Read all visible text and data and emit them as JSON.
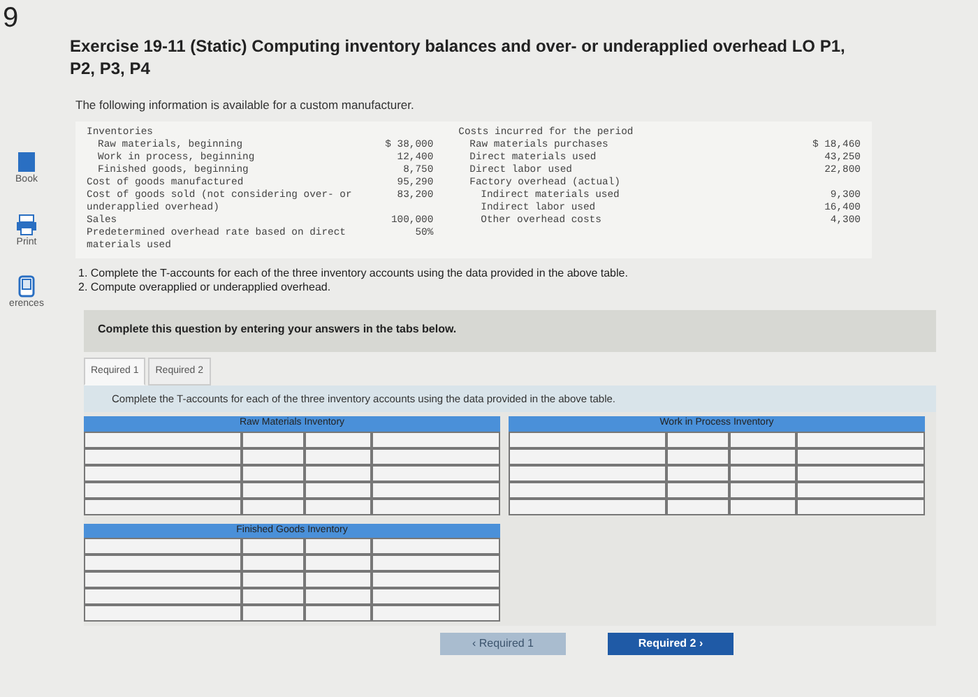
{
  "question_number": "9",
  "sidebar": [
    {
      "label": "Book",
      "kind": "book"
    },
    {
      "label": "Print",
      "kind": "print"
    },
    {
      "label": "erences",
      "kind": "references"
    }
  ],
  "title": "Exercise 19-11 (Static) Computing inventory balances and over- or underapplied overhead LO P1, P2, P3, P4",
  "intro": "The following information is available for a custom manufacturer.",
  "left_table": [
    {
      "label": "Inventories",
      "children": [
        {
          "label": "Raw materials, beginning",
          "value": "$ 38,000"
        },
        {
          "label": "Work in process, beginning",
          "value": "12,400"
        },
        {
          "label": "Finished goods, beginning",
          "value": "8,750"
        }
      ]
    },
    {
      "label": "Cost of goods manufactured",
      "value": "95,290"
    },
    {
      "label": "Cost of goods sold (not considering over- or underapplied overhead)",
      "value": "83,200"
    },
    {
      "label": "Sales",
      "value": "100,000"
    },
    {
      "label": "Predetermined overhead rate based on direct materials used",
      "value": "50%"
    }
  ],
  "right_table": [
    {
      "label": "Costs incurred for the period",
      "children": [
        {
          "label": "Raw materials purchases",
          "value": "$ 18,460"
        },
        {
          "label": "Direct materials used",
          "value": "43,250"
        },
        {
          "label": "Direct labor used",
          "value": "22,800"
        },
        {
          "label": "Factory overhead (actual)",
          "children": [
            {
              "label": "Indirect materials used",
              "value": "9,300"
            },
            {
              "label": "Indirect labor used",
              "value": "16,400"
            },
            {
              "label": "Other overhead costs",
              "value": "4,300"
            }
          ]
        }
      ]
    }
  ],
  "instructions": [
    "1. Complete the T-accounts for each of the three inventory accounts using the data provided in the above table.",
    "2. Compute overapplied or underapplied overhead."
  ],
  "banner": "Complete this question by entering your answers in the tabs below.",
  "tabs": [
    {
      "label": "Required 1",
      "selected": true
    },
    {
      "label": "Required 2",
      "selected": false
    }
  ],
  "tab_prompt": "Complete the T-accounts for each of the three inventory accounts using the data provided in the above table.",
  "t_accounts": [
    {
      "title": "Raw Materials Inventory"
    },
    {
      "title": "Finished Goods Inventory"
    },
    {
      "title": "Work in Process Inventory"
    }
  ],
  "nav_buttons": [
    {
      "arrow_before": "‹",
      "label": "Required 1",
      "disabled": true
    },
    {
      "label": "Required 2",
      "arrow_after": "›",
      "disabled": false
    }
  ]
}
